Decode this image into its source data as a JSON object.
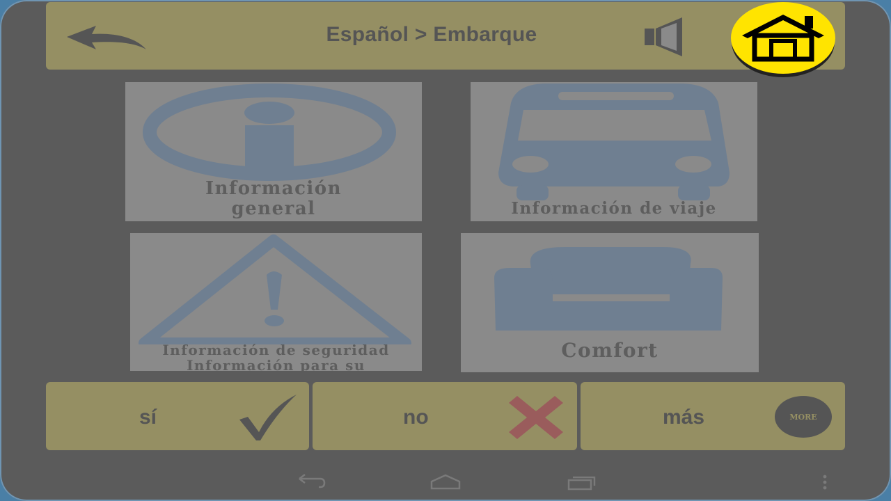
{
  "header": {
    "title": "Español > Embarque",
    "back_icon": "back-arrow-icon",
    "speaker_icon": "speaker-icon",
    "home_icon": "home-icon"
  },
  "tiles": [
    {
      "label_lines": [
        "Información",
        "general"
      ],
      "icon": "info-icon"
    },
    {
      "label_lines": [
        "Información de viaje"
      ],
      "icon": "bus-icon"
    },
    {
      "label_lines": [
        "Información de seguridad",
        "Información para su"
      ],
      "icon": "warning-icon"
    },
    {
      "label_lines": [
        "Comfort"
      ],
      "icon": "armchair-icon"
    }
  ],
  "bottom": {
    "yes_label": "sí",
    "no_label": "no",
    "more_label": "más",
    "more_badge": "MORE"
  },
  "navbar": {
    "icons": [
      "nav-back-icon",
      "nav-home-icon",
      "nav-recents-icon",
      "nav-menu-icon"
    ]
  },
  "colors": {
    "bar_bg": "#958f63",
    "home_bg": "#ffe400",
    "icon_blue": "#6f7f91",
    "tile_bg": "#8a8a8a",
    "screen_bg": "#5b5b5b"
  }
}
